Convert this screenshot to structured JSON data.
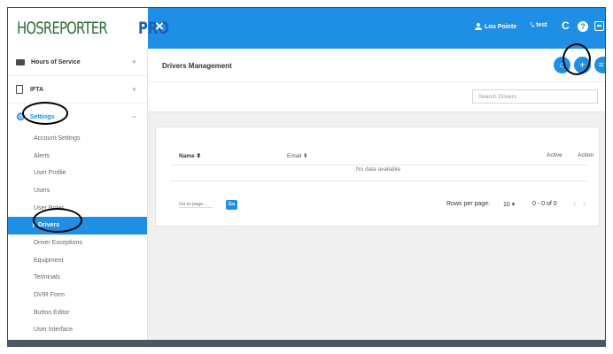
{
  "header": {
    "logo_main": "HOSREPORTER",
    "logo_pro": "PRO",
    "close_glyph": "×",
    "user_name": "Lou Pointe",
    "language": "test",
    "refresh_glyph": "C",
    "help_glyph": "?"
  },
  "sidebar": {
    "hours_of_service": {
      "label": "Hours of Service",
      "caret": "+"
    },
    "ifta": {
      "label": "IFTA",
      "caret": "+"
    },
    "settings": {
      "label": "Settings",
      "caret": "−"
    },
    "sub_items": [
      "Account Settings",
      "Alerts",
      "User Profile",
      "Users",
      "User Roles",
      "Drivers",
      "Driver Exceptions",
      "Equipment",
      "Terminals",
      "DVIR Form",
      "Button Editor",
      "User Interface"
    ],
    "active_item": "Drivers"
  },
  "page": {
    "title": "Drivers Management",
    "search_placeholder": "Search Drivers",
    "header_buttons": {
      "home_glyph": "⌂",
      "add_glyph": "+",
      "options_glyph": "≡"
    }
  },
  "table": {
    "columns": [
      "Name ⬍",
      "Email ⬍",
      "Active",
      "Action"
    ],
    "empty_message": "No data available",
    "goto_placeholder": "Go to page...",
    "go_label": "Go",
    "rows_per_page_label": "Rows per page:",
    "rows_per_page_value": "10 ▾",
    "range": "0 - 0 of 0",
    "prev_glyph": "‹",
    "next_glyph": "›"
  },
  "colors": {
    "primary": "#1f8fe6",
    "annotation_ring": "#000000",
    "bottom_strip": "#4b5763"
  }
}
